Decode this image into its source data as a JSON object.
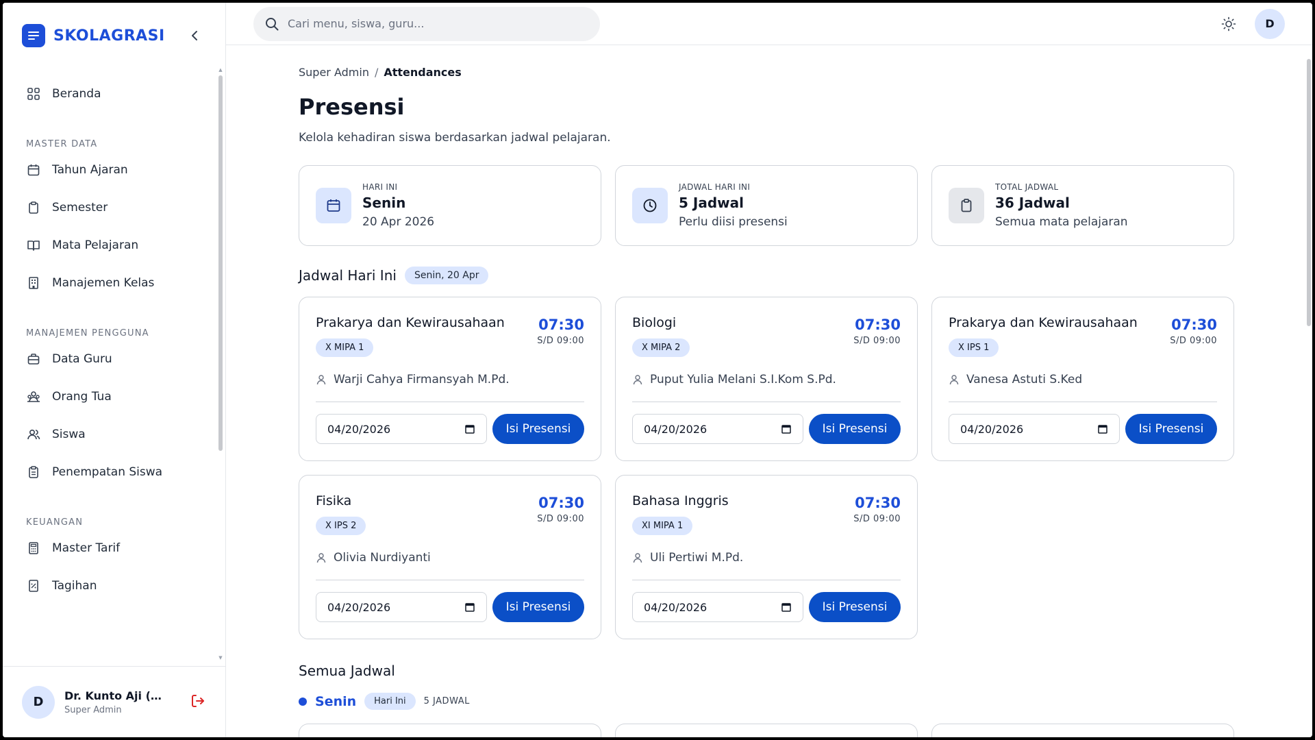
{
  "app": {
    "name": "SKOLAGRASI"
  },
  "sidebar": {
    "items": [
      {
        "label": "Beranda"
      }
    ],
    "sections": [
      {
        "title": "MASTER DATA",
        "items": [
          {
            "label": "Tahun Ajaran"
          },
          {
            "label": "Semester"
          },
          {
            "label": "Mata Pelajaran"
          },
          {
            "label": "Manajemen Kelas"
          }
        ]
      },
      {
        "title": "MANAJEMEN PENGGUNA",
        "items": [
          {
            "label": "Data Guru"
          },
          {
            "label": "Orang Tua"
          },
          {
            "label": "Siswa"
          },
          {
            "label": "Penempatan Siswa"
          }
        ]
      },
      {
        "title": "KEUANGAN",
        "items": [
          {
            "label": "Master Tarif"
          },
          {
            "label": "Tagihan"
          }
        ]
      }
    ]
  },
  "user": {
    "initial": "D",
    "name": "Dr. Kunto Aji (Ke...",
    "role": "Super Admin"
  },
  "topbar": {
    "search_placeholder": "Cari menu, siswa, guru...",
    "avatar_initial": "D"
  },
  "breadcrumb": {
    "root": "Super Admin",
    "sep": "/",
    "current": "Attendances"
  },
  "page": {
    "title": "Presensi",
    "subtitle": "Kelola kehadiran siswa berdasarkan jadwal pelajaran."
  },
  "stats": [
    {
      "label": "HARI INI",
      "value": "Senin",
      "desc": "20 Apr 2026",
      "icon": "calendar-icon"
    },
    {
      "label": "JADWAL HARI INI",
      "value": "5 Jadwal",
      "desc": "Perlu diisi presensi",
      "icon": "clock-icon"
    },
    {
      "label": "TOTAL JADWAL",
      "value": "36 Jadwal",
      "desc": "Semua mata pelajaran",
      "icon": "clipboard-icon"
    }
  ],
  "today": {
    "title": "Jadwal Hari Ini",
    "badge": "Senin, 20 Apr",
    "cards": [
      {
        "subject": "Prakarya dan Kewirausahaan",
        "class": "X MIPA 1",
        "teacher": "Warji Cahya Firmansyah M.Pd.",
        "start": "07:30",
        "end": "S/D 09:00",
        "date": "04/20/2026",
        "action": "Isi Presensi"
      },
      {
        "subject": "Biologi",
        "class": "X MIPA 2",
        "teacher": "Puput Yulia Melani S.I.Kom S.Pd.",
        "start": "07:30",
        "end": "S/D 09:00",
        "date": "04/20/2026",
        "action": "Isi Presensi"
      },
      {
        "subject": "Prakarya dan Kewirausahaan",
        "class": "X IPS 1",
        "teacher": "Vanesa Astuti S.Ked",
        "start": "07:30",
        "end": "S/D 09:00",
        "date": "04/20/2026",
        "action": "Isi Presensi"
      },
      {
        "subject": "Fisika",
        "class": "X IPS 2",
        "teacher": "Olivia Nurdiyanti",
        "start": "07:30",
        "end": "S/D 09:00",
        "date": "04/20/2026",
        "action": "Isi Presensi"
      },
      {
        "subject": "Bahasa Inggris",
        "class": "XI MIPA 1",
        "teacher": "Uli Pertiwi M.Pd.",
        "start": "07:30",
        "end": "S/D 09:00",
        "date": "04/20/2026",
        "action": "Isi Presensi"
      }
    ]
  },
  "all": {
    "title": "Semua Jadwal",
    "day": "Senin",
    "day_badge": "Hari Ini",
    "count": "5 JADWAL"
  },
  "colors": {
    "primary": "#1d4ed8",
    "button": "#0b4fc7",
    "pill_bg": "#dbe6fe",
    "logout": "#dc2626"
  }
}
